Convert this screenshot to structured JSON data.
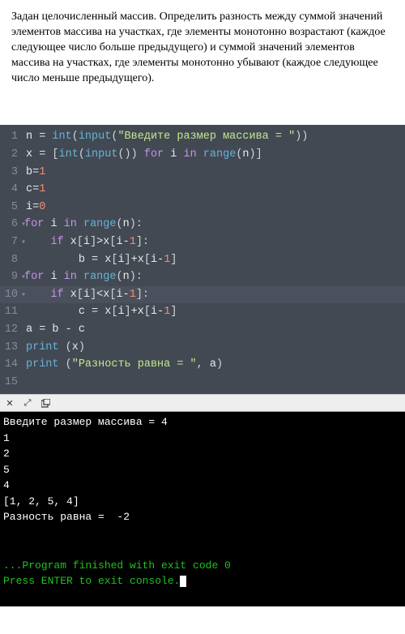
{
  "problem": "Задан целочисленный массив. Определить разность между суммой значений элементов массива на участках, где элементы монотонно возрастают (каждое следующее число больше предыдущего) и суммой значений элементов массива на участках, где элементы монотонно убывают (каждое следующее число меньше предыдущего).",
  "code": {
    "lines": [
      {
        "n": "1",
        "fold": false,
        "tokens": [
          [
            "var",
            "n "
          ],
          [
            "op",
            "= "
          ],
          [
            "func",
            "int"
          ],
          [
            "punc",
            "("
          ],
          [
            "func",
            "input"
          ],
          [
            "punc",
            "("
          ],
          [
            "str",
            "\"Введите размер массива = \""
          ],
          [
            "punc",
            "))"
          ]
        ]
      },
      {
        "n": "2",
        "fold": false,
        "tokens": [
          [
            "var",
            "x "
          ],
          [
            "op",
            "= "
          ],
          [
            "punc",
            "["
          ],
          [
            "func",
            "int"
          ],
          [
            "punc",
            "("
          ],
          [
            "func",
            "input"
          ],
          [
            "punc",
            "()) "
          ],
          [
            "kw",
            "for"
          ],
          [
            "var",
            " i "
          ],
          [
            "kw",
            "in"
          ],
          [
            "var",
            " "
          ],
          [
            "func",
            "range"
          ],
          [
            "punc",
            "("
          ],
          [
            "var",
            "n"
          ],
          [
            "punc",
            ")]"
          ]
        ]
      },
      {
        "n": "3",
        "fold": false,
        "tokens": [
          [
            "var",
            "b"
          ],
          [
            "op",
            "="
          ],
          [
            "num",
            "1"
          ]
        ]
      },
      {
        "n": "4",
        "fold": false,
        "tokens": [
          [
            "var",
            "c"
          ],
          [
            "op",
            "="
          ],
          [
            "num",
            "1"
          ]
        ]
      },
      {
        "n": "5",
        "fold": false,
        "tokens": [
          [
            "var",
            "i"
          ],
          [
            "op",
            "="
          ],
          [
            "num",
            "0"
          ]
        ]
      },
      {
        "n": "6",
        "fold": true,
        "tokens": [
          [
            "kw",
            "for"
          ],
          [
            "var",
            " i "
          ],
          [
            "kw",
            "in"
          ],
          [
            "var",
            " "
          ],
          [
            "func",
            "range"
          ],
          [
            "punc",
            "("
          ],
          [
            "var",
            "n"
          ],
          [
            "punc",
            "):"
          ]
        ]
      },
      {
        "n": "7",
        "fold": true,
        "indent": "    ",
        "tokens": [
          [
            "kw",
            "if"
          ],
          [
            "var",
            " x"
          ],
          [
            "punc",
            "["
          ],
          [
            "var",
            "i"
          ],
          [
            "punc",
            "]"
          ],
          [
            "op",
            ">"
          ],
          [
            "var",
            "x"
          ],
          [
            "punc",
            "["
          ],
          [
            "var",
            "i"
          ],
          [
            "op",
            "-"
          ],
          [
            "num",
            "1"
          ],
          [
            "punc",
            "]:"
          ]
        ]
      },
      {
        "n": "8",
        "fold": false,
        "indent": "        ",
        "tokens": [
          [
            "var",
            "b "
          ],
          [
            "op",
            "= "
          ],
          [
            "var",
            "x"
          ],
          [
            "punc",
            "["
          ],
          [
            "var",
            "i"
          ],
          [
            "punc",
            "]"
          ],
          [
            "op",
            "+"
          ],
          [
            "var",
            "x"
          ],
          [
            "punc",
            "["
          ],
          [
            "var",
            "i"
          ],
          [
            "op",
            "-"
          ],
          [
            "num",
            "1"
          ],
          [
            "punc",
            "]"
          ]
        ]
      },
      {
        "n": "9",
        "fold": true,
        "tokens": [
          [
            "kw",
            "for"
          ],
          [
            "var",
            " i "
          ],
          [
            "kw",
            "in"
          ],
          [
            "var",
            " "
          ],
          [
            "func",
            "range"
          ],
          [
            "punc",
            "("
          ],
          [
            "var",
            "n"
          ],
          [
            "punc",
            "):"
          ]
        ]
      },
      {
        "n": "10",
        "fold": true,
        "indent": "    ",
        "hl": true,
        "tokens": [
          [
            "kw",
            "if"
          ],
          [
            "var",
            " x"
          ],
          [
            "punc",
            "["
          ],
          [
            "var",
            "i"
          ],
          [
            "punc",
            "]"
          ],
          [
            "op",
            "<"
          ],
          [
            "var",
            "x"
          ],
          [
            "punc",
            "["
          ],
          [
            "var",
            "i"
          ],
          [
            "op",
            "-"
          ],
          [
            "num",
            "1"
          ],
          [
            "punc",
            "]:"
          ]
        ]
      },
      {
        "n": "11",
        "fold": false,
        "indent": "        ",
        "tokens": [
          [
            "var",
            "c "
          ],
          [
            "op",
            "= "
          ],
          [
            "var",
            "x"
          ],
          [
            "punc",
            "["
          ],
          [
            "var",
            "i"
          ],
          [
            "punc",
            "]"
          ],
          [
            "op",
            "+"
          ],
          [
            "var",
            "x"
          ],
          [
            "punc",
            "["
          ],
          [
            "var",
            "i"
          ],
          [
            "op",
            "-"
          ],
          [
            "num",
            "1"
          ],
          [
            "punc",
            "]"
          ]
        ]
      },
      {
        "n": "12",
        "fold": false,
        "tokens": [
          [
            "var",
            "a "
          ],
          [
            "op",
            "= "
          ],
          [
            "var",
            "b "
          ],
          [
            "op",
            "- "
          ],
          [
            "var",
            "c"
          ]
        ]
      },
      {
        "n": "13",
        "fold": false,
        "tokens": [
          [
            "func",
            "print"
          ],
          [
            "var",
            " "
          ],
          [
            "punc",
            "("
          ],
          [
            "var",
            "x"
          ],
          [
            "punc",
            ")"
          ]
        ]
      },
      {
        "n": "14",
        "fold": false,
        "tokens": [
          [
            "func",
            "print"
          ],
          [
            "var",
            " "
          ],
          [
            "punc",
            "("
          ],
          [
            "str",
            "\"Разность равна = \""
          ],
          [
            "punc",
            ", "
          ],
          [
            "var",
            "a"
          ],
          [
            "punc",
            ")"
          ]
        ]
      },
      {
        "n": "15",
        "fold": false,
        "tokens": []
      }
    ]
  },
  "toolbar_icons": [
    "close",
    "expand",
    "window"
  ],
  "console": {
    "lines": [
      "Введите размер массива = 4",
      "1",
      "2",
      "5",
      "4",
      "[1, 2, 5, 4]",
      "Разность равна =  -2"
    ],
    "exit": "...Program finished with exit code 0",
    "prompt": "Press ENTER to exit console."
  }
}
